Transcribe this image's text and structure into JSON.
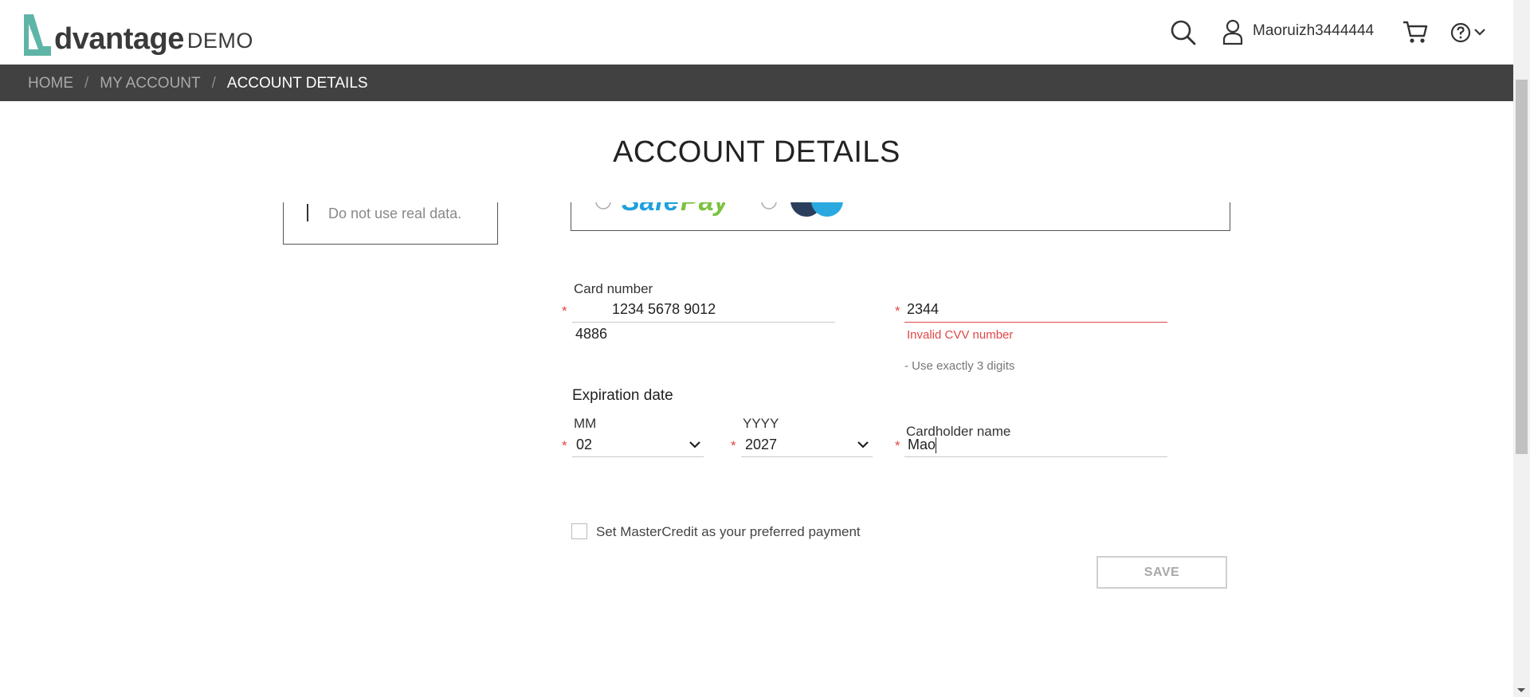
{
  "header": {
    "logo_text": "dvantage",
    "logo_demo": "DEMO",
    "username": "Maoruizh3444444",
    "icons": [
      "search-icon",
      "user-icon",
      "cart-icon",
      "help-icon",
      "chevron-down-icon"
    ]
  },
  "breadcrumb": {
    "items": [
      "HOME",
      "MY ACCOUNT",
      "ACCOUNT DETAILS"
    ],
    "separator": "/"
  },
  "page": {
    "title": "ACCOUNT DETAILS"
  },
  "info": {
    "text": "Do not use real data."
  },
  "form": {
    "required_mark": "*",
    "card_number": {
      "label": "Card number",
      "value_line1": "1234 5678 9012",
      "value_line2": "4886"
    },
    "cvv": {
      "value": "2344",
      "error": "Invalid CVV number",
      "hint": "- Use exactly 3 digits"
    },
    "expiration": {
      "title": "Expiration date",
      "month_label": "MM",
      "month_value": "02",
      "year_label": "YYYY",
      "year_value": "2027"
    },
    "cardholder": {
      "label": "Cardholder name",
      "value": "Mao"
    },
    "preferred_label": "Set MasterCredit as your preferred payment",
    "save_label": "SAVE"
  },
  "colors": {
    "accent": "#5fb4a8",
    "error": "#e24646",
    "breadcrumb_bg": "#414141"
  }
}
